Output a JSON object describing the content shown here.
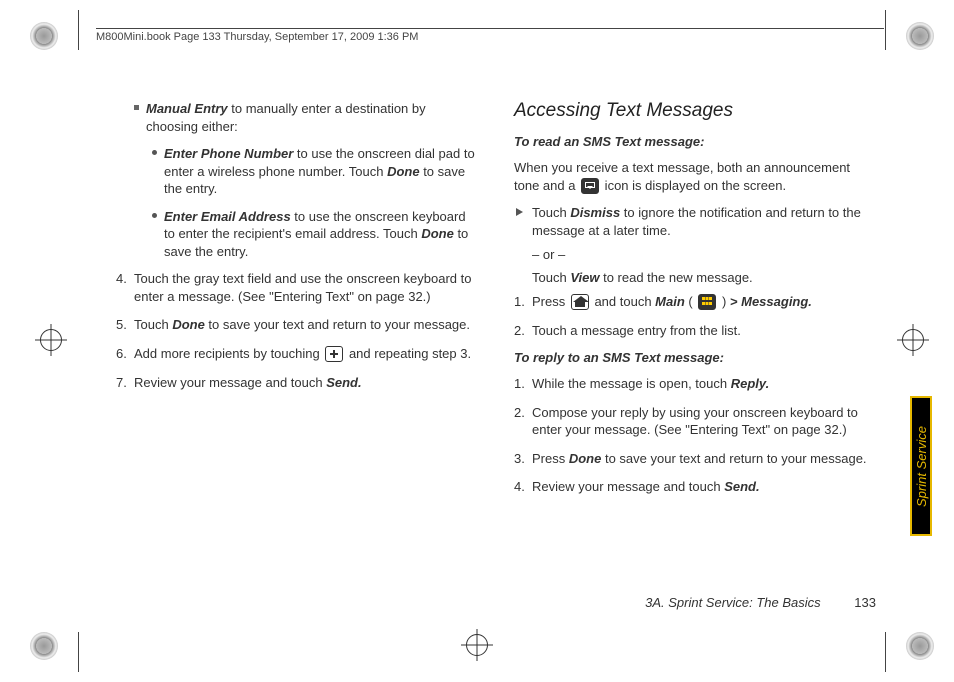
{
  "header_text": "M800Mini.book  Page 133  Thursday, September 17, 2009  1:36 PM",
  "left": {
    "manual_entry_lead_bold": "Manual Entry",
    "manual_entry_lead_rest": " to manually enter a destination by choosing either:",
    "enter_phone_bold": "Enter Phone Number",
    "enter_phone_rest": " to use the onscreen dial pad to enter a wireless phone number. Touch ",
    "done1": "Done",
    "enter_phone_tail": " to save the entry.",
    "enter_email_bold": "Enter Email Address",
    "enter_email_rest": " to use the onscreen keyboard to enter the recipient's email address. Touch ",
    "done2": "Done",
    "enter_email_tail": " to save the entry.",
    "s4_num": "4.",
    "s4": "Touch the gray text field and use the onscreen keyboard to enter a message. (See \"Entering Text\" on page 32.)",
    "s5_num": "5.",
    "s5_a": "Touch ",
    "s5_done": "Done",
    "s5_b": " to save your text and return to your message.",
    "s6_num": "6.",
    "s6_a": "Add more recipients by touching ",
    "s6_b": " and repeating step 3.",
    "s7_num": "7.",
    "s7_a": "Review your message and touch ",
    "s7_send": "Send.",
    "": ""
  },
  "right": {
    "h2": "Accessing Text Messages",
    "h3a": "To read an SMS Text message:",
    "p1a": "When you receive a text message, both an announcement tone and a ",
    "p1b": " icon is displayed on the screen.",
    "dismiss_a": "Touch ",
    "dismiss_b": "Dismiss",
    "dismiss_c": " to ignore the notification and return to the message at a later time.",
    "or": "– or –",
    "view_a": "Touch ",
    "view_b": "View",
    "view_c": " to read the new message.",
    "r1_num": "1.",
    "r1_a": "Press ",
    "r1_b": " and touch ",
    "r1_main": "Main",
    "r1_paren_open": " ( ",
    "r1_paren_close": " ) ",
    "r1_gt": ">",
    "r1_msg": " Messaging.",
    "r2_num": "2.",
    "r2": "Touch a message entry from the list.",
    "h3b": "To reply to an SMS Text message:",
    "q1_num": "1.",
    "q1_a": "While the message is open, touch ",
    "q1_reply": "Reply.",
    "q2_num": "2.",
    "q2": "Compose your reply by using your onscreen keyboard to enter your message. (See \"Entering Text\" on page 32.)",
    "q3_num": "3.",
    "q3_a": "Press ",
    "q3_done": "Done",
    "q3_b": " to save your text and return to your message.",
    "q4_num": "4.",
    "q4_a": "Review your message and touch ",
    "q4_send": "Send."
  },
  "footer_section": "3A. Sprint Service: The Basics",
  "footer_page": "133",
  "side_tab": "Sprint Service"
}
